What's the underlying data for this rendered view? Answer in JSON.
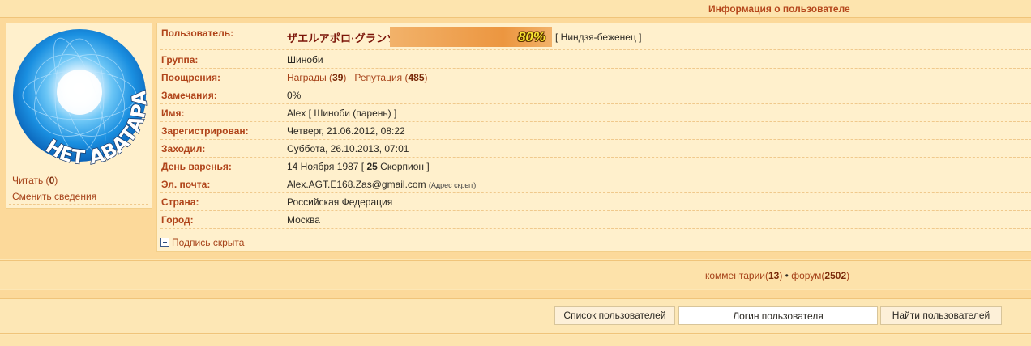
{
  "header": {
    "title": "Информация о пользователе"
  },
  "avatar": {
    "text": "НЕТ АВАТАРА"
  },
  "left_links": {
    "read": {
      "label": "Читать (",
      "count": "0",
      "suffix": ")"
    },
    "edit": {
      "label": "Сменить сведения"
    }
  },
  "profile": {
    "user_label": "Пользователь:",
    "username": "ザエルアポロ·グランツ",
    "progress_text": "80%",
    "progress_value": 0.8,
    "rank": "[ Ниндзя-беженец ]",
    "group_label": "Группа:",
    "group": "Шиноби",
    "rewards_label": "Поощрения:",
    "awards_text": "Награды (",
    "awards_count": "39",
    "awards_close": ")",
    "rep_text": "Репутация (",
    "rep_count": "485",
    "rep_close": ")",
    "warnings_label": "Замечания:",
    "warnings": "0%",
    "name_label": "Имя:",
    "name": "Alex [ Шиноби (парень) ]",
    "registered_label": "Зарегистрирован:",
    "registered": "Четверг, 21.06.2012, 08:22",
    "last_visit_label": "Заходил:",
    "last_visit": "Суббота, 26.10.2013, 07:01",
    "birthday_label": "День варенья:",
    "birthday_pre": "14 Ноября 1987 [ ",
    "birthday_age": "25",
    "birthday_post": " Скорпион ]",
    "email_label": "Эл. почта:",
    "email": "Alex.AGT.E168.Zas@gmail.com",
    "email_note": "(Адрес скрыт)",
    "country_label": "Страна:",
    "country": "Российская Федерация",
    "city_label": "Город:",
    "city": "Москва",
    "signature_toggle": "Подпись скрыта"
  },
  "stats": {
    "comments_label": "комментарии(",
    "comments_count": "13",
    "comments_close": ")",
    "separator": " • ",
    "forum_label": "форум(",
    "forum_count": "2502",
    "forum_close": ")"
  },
  "bottom": {
    "user_list_button": "Список пользователей",
    "login_input_value": "Логин пользователя",
    "find_button": "Найти пользователей"
  },
  "colors": {
    "background": "#fde7b5",
    "panel": "#fff0cc",
    "label": "#b0441a",
    "link": "#a64219",
    "username": "#7b1408",
    "progress_bar": "#ec9640"
  }
}
